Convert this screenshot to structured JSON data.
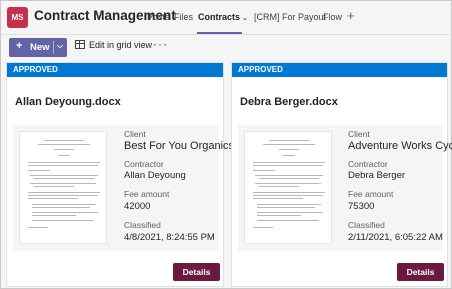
{
  "app": {
    "icon_text": "MS",
    "title": "Contract Management"
  },
  "tabs": [
    {
      "label": "Posts"
    },
    {
      "label": "Files"
    },
    {
      "label": "Contracts",
      "active": true
    },
    {
      "label": "[CRM] For Payout"
    },
    {
      "label": "Flow"
    }
  ],
  "add_tab_icon": "plus-icon",
  "toolbar": {
    "new_label": "New",
    "grid_label": "Edit in grid view",
    "more_label": "···"
  },
  "colors": {
    "accent": "#6264a7",
    "status_bar": "#0078d4",
    "details_button": "#6b1a3d",
    "app_tile": "#c4314b"
  },
  "labels": {
    "client": "Client",
    "contractor": "Contractor",
    "fee": "Fee amount",
    "classified": "Classified",
    "details": "Details"
  },
  "cards": [
    {
      "status": "APPROVED",
      "file_name": "Allan Deyoung.docx",
      "client": "Best For You Organics",
      "contractor": "Allan Deyoung",
      "fee": "42000",
      "classified": "4/8/2021, 8:24:55 PM"
    },
    {
      "status": "APPROVED",
      "file_name": "Debra Berger.docx",
      "client": "Adventure Works Cycles",
      "contractor": "Debra Berger",
      "fee": "75300",
      "classified": "2/11/2021, 6:05:22 AM"
    }
  ]
}
